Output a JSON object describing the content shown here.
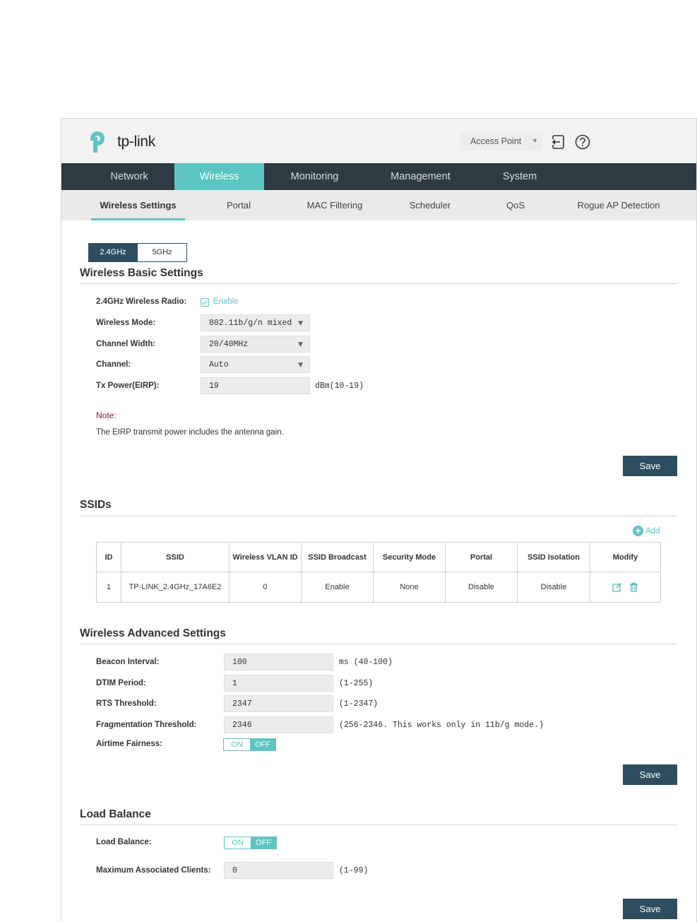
{
  "header": {
    "logo_text": "tp-link",
    "mode_select": "Access Point",
    "icons": [
      "logout-icon",
      "help-icon"
    ]
  },
  "main_nav": [
    {
      "label": "Network"
    },
    {
      "label": "Wireless",
      "active": true
    },
    {
      "label": "Monitoring"
    },
    {
      "label": "Management"
    },
    {
      "label": "System"
    }
  ],
  "sub_nav": [
    {
      "label": "Wireless Settings",
      "active": true
    },
    {
      "label": "Portal"
    },
    {
      "label": "MAC Filtering"
    },
    {
      "label": "Scheduler"
    },
    {
      "label": "QoS"
    },
    {
      "label": "Rogue AP Detection"
    }
  ],
  "band_tabs": {
    "b24": "2.4GHz",
    "b5": "5GHz",
    "selected": "2.4GHz"
  },
  "basic": {
    "title": "Wireless Basic Settings",
    "radio_label": "2.4GHz Wireless Radio:",
    "radio_enable": "Enable",
    "mode_label": "Wireless Mode:",
    "mode_value": "802.11b/g/n mixed",
    "width_label": "Channel Width:",
    "width_value": "20/40MHz",
    "channel_label": "Channel:",
    "channel_value": "Auto",
    "tx_label": "Tx Power(EIRP):",
    "tx_value": "19",
    "tx_hint": "dBm(10-19)",
    "note_title": "Note:",
    "note_text": "The EIRP transmit power includes the antenna gain.",
    "save": "Save"
  },
  "ssids": {
    "title": "SSIDs",
    "add": "Add",
    "columns": [
      "ID",
      "SSID",
      "Wireless VLAN ID",
      "SSID Broadcast",
      "Security Mode",
      "Portal",
      "SSID Isolation",
      "Modify"
    ],
    "rows": [
      {
        "id": "1",
        "ssid": "TP-LINK_2.4GHz_17A6E2",
        "vlan": "0",
        "broadcast": "Enable",
        "security": "None",
        "portal": "Disable",
        "isolation": "Disable"
      }
    ]
  },
  "advanced": {
    "title": "Wireless Advanced Settings",
    "beacon_label": "Beacon Interval:",
    "beacon_value": "100",
    "beacon_hint": "ms (40-100)",
    "dtim_label": "DTIM Period:",
    "dtim_value": "1",
    "dtim_hint": "(1-255)",
    "rts_label": "RTS Threshold:",
    "rts_value": "2347",
    "rts_hint": "(1-2347)",
    "frag_label": "Fragmentation Threshold:",
    "frag_value": "2346",
    "frag_hint": "(256-2346. This works only in 11b/g mode.)",
    "airtime_label": "Airtime Fairness:",
    "toggle_on": "ON",
    "toggle_off": "OFF",
    "airtime_state": "OFF",
    "save": "Save"
  },
  "load_balance": {
    "title": "Load Balance",
    "lb_label": "Load Balance:",
    "toggle_on": "ON",
    "toggle_off": "OFF",
    "lb_state": "OFF",
    "max_label": "Maximum Associated Clients:",
    "max_value": "0",
    "max_hint": "(1-99)",
    "save": "Save"
  },
  "colors": {
    "accent": "#5bc6c1",
    "nav_bg": "#2e3b43",
    "button_bg": "#2e4e5f",
    "note": "#8a1c3c"
  }
}
